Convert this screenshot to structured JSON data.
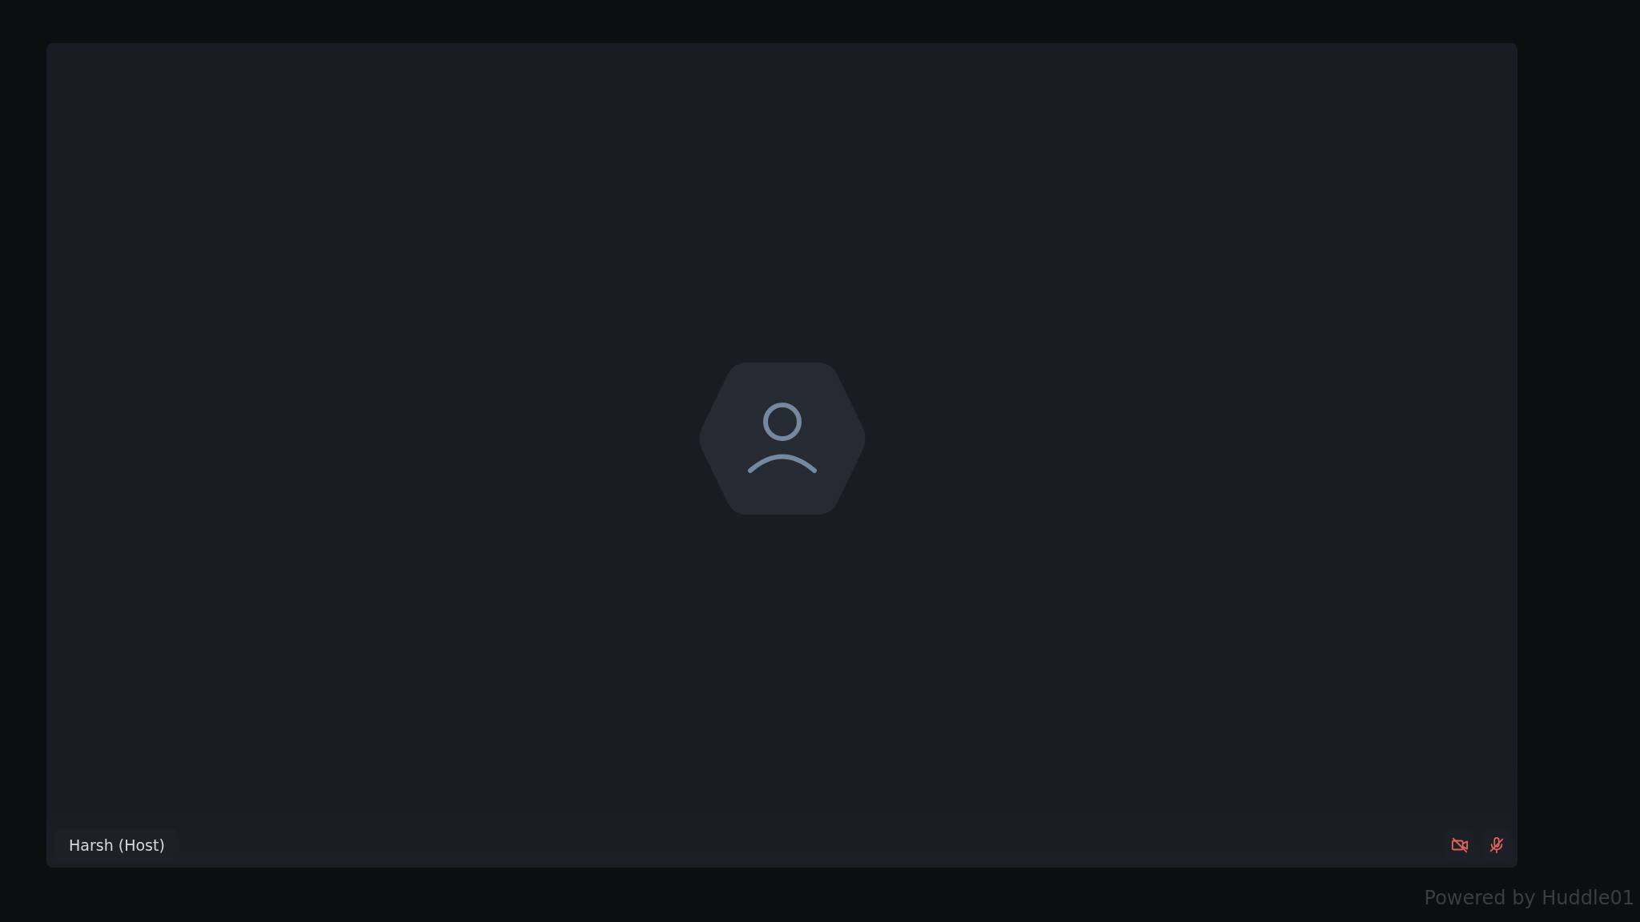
{
  "tile": {
    "name": "Harsh (Host)",
    "camera_on": false,
    "mic_on": false
  },
  "footer": "Powered by Huddle01"
}
